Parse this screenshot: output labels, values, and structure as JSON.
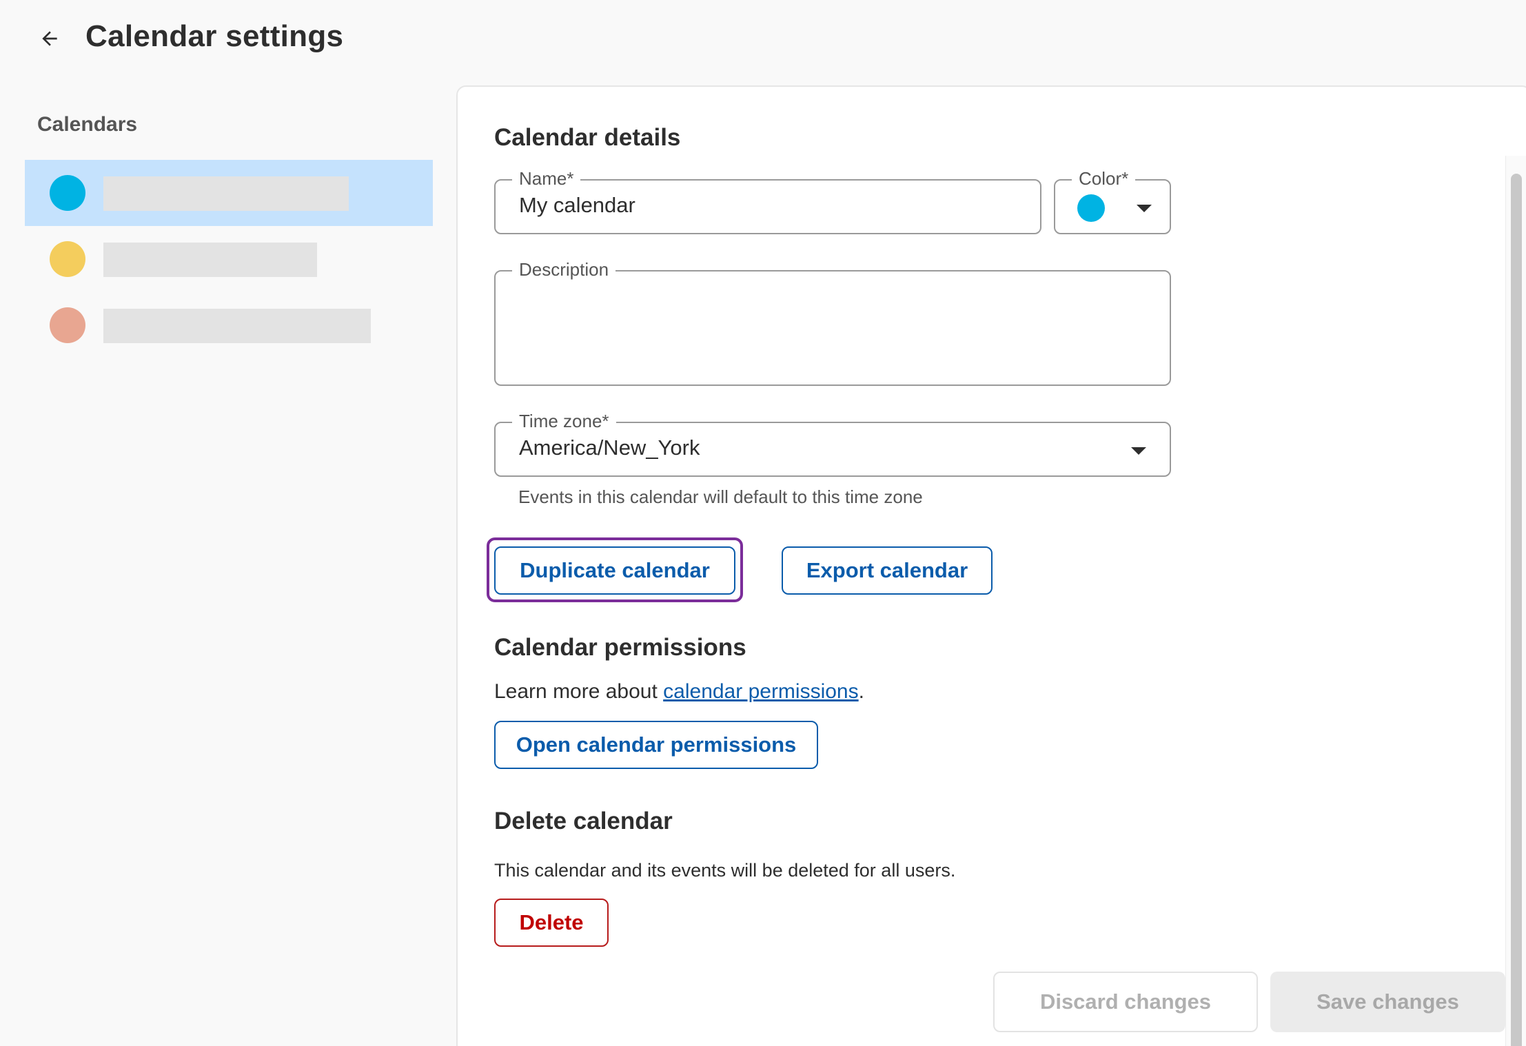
{
  "header": {
    "title": "Calendar settings",
    "back_icon": "arrow-left-icon"
  },
  "sidebar": {
    "title": "Calendars",
    "calendars": [
      {
        "color": "#00b3e3",
        "selected": true
      },
      {
        "color": "#f4cd5d",
        "selected": false
      },
      {
        "color": "#e8a691",
        "selected": false
      }
    ]
  },
  "details": {
    "title": "Calendar details",
    "name": {
      "label": "Name",
      "required_mark": "*",
      "value": "My calendar"
    },
    "color": {
      "label": "Color",
      "required_mark": "*",
      "value": "#00b3e3"
    },
    "description": {
      "label": "Description",
      "value": ""
    },
    "timezone": {
      "label": "Time zone",
      "required_mark": "*",
      "value": "America/New_York",
      "helper": "Events in this calendar will default to this time zone"
    },
    "duplicate_label": "Duplicate calendar",
    "export_label": "Export calendar"
  },
  "permissions": {
    "title": "Calendar permissions",
    "learn_prefix": "Learn more about ",
    "learn_link": "calendar permissions",
    "learn_suffix": ".",
    "open_label": "Open calendar permissions"
  },
  "delete": {
    "title": "Delete calendar",
    "text": "This calendar and its events will be deleted for all users.",
    "button_label": "Delete"
  },
  "footer": {
    "discard_label": "Discard changes",
    "save_label": "Save changes"
  },
  "colors": {
    "accent": "#0b5cab",
    "danger": "#c00000",
    "focus": "#7b2d9a",
    "selected_bg": "#c5e2fd"
  }
}
